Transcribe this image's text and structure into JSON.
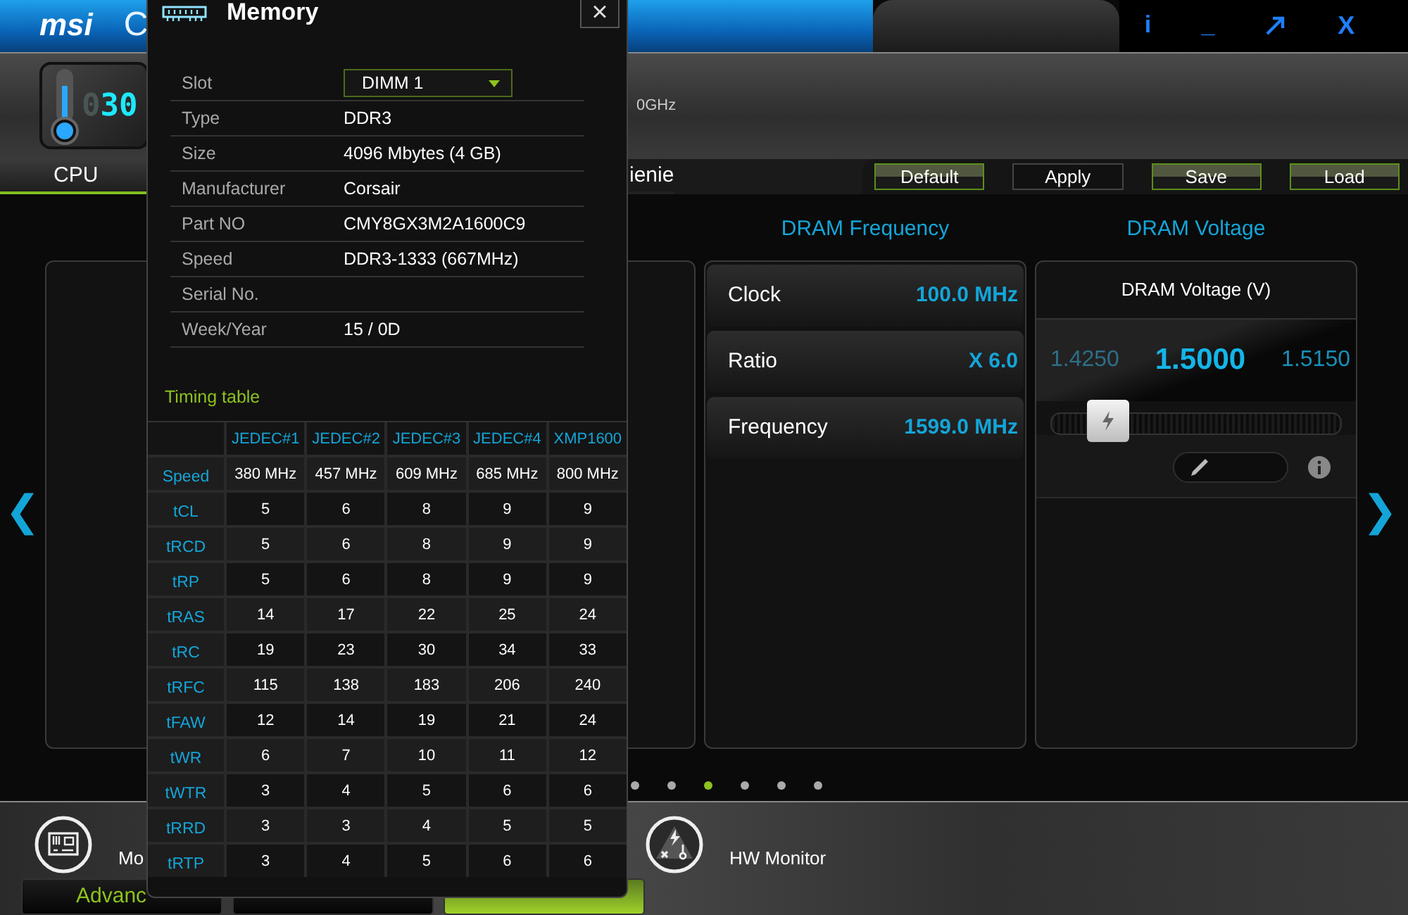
{
  "app": {
    "logo": "msi",
    "title": "C",
    "info": "i",
    "minimize": "_",
    "close": "X"
  },
  "temperature": {
    "dim_digit": "0",
    "digits": "30"
  },
  "cpu_info": "0GHz",
  "tabs": [
    {
      "label": "CPU",
      "selected": true
    },
    {
      "label": "ienie",
      "selected": false
    }
  ],
  "actions": [
    {
      "label": "Default",
      "kind": "green"
    },
    {
      "label": "Apply",
      "kind": "dark"
    },
    {
      "label": "Save",
      "kind": "green"
    },
    {
      "label": "Load",
      "kind": "green"
    }
  ],
  "headings": [
    "DRAM Frequency",
    "DRAM Voltage"
  ],
  "frequency": [
    {
      "label": "Clock",
      "value": "100.0 MHz"
    },
    {
      "label": "Ratio",
      "value": "X 6.0"
    },
    {
      "label": "Frequency",
      "value": "1599.0 MHz"
    }
  ],
  "voltage": {
    "title": "DRAM Voltage (V)",
    "previous": "1.4250",
    "current": "1.5000",
    "next": "1.5150",
    "level": 0.2
  },
  "nav": {
    "prev": "❮",
    "next": "❯"
  },
  "pager": [
    {
      "selected": false
    },
    {
      "selected": false
    },
    {
      "selected": true
    },
    {
      "selected": false
    },
    {
      "selected": false
    },
    {
      "selected": false
    }
  ],
  "bottom": {
    "items": [
      {
        "label": "Mo",
        "kind": "board"
      },
      {
        "label": "HW Monitor",
        "kind": "monitor"
      }
    ],
    "tabs": [
      {
        "label": "Advanc",
        "selected": false
      },
      {
        "selected": false
      },
      {
        "selected": true
      }
    ]
  },
  "dialog": {
    "title": "Memory",
    "close": "×",
    "slot": {
      "label": "Slot",
      "value": "DIMM 1"
    },
    "rows": [
      {
        "label": "Type",
        "value": "DDR3"
      },
      {
        "label": "Size",
        "value": "4096 Mbytes (4 GB)"
      },
      {
        "label": "Manufacturer",
        "value": "Corsair"
      },
      {
        "label": "Part NO",
        "value": "CMY8GX3M2A1600C9"
      },
      {
        "label": "Speed",
        "value": "DDR3-1333 (667MHz)"
      },
      {
        "label": "Serial No."
      },
      {
        "label": "Week/Year",
        "value": "15 / 0D"
      }
    ],
    "timing_title": "Timing table",
    "timing": {
      "columns": [
        "JEDEC#1",
        "JEDEC#2",
        "JEDEC#3",
        "JEDEC#4",
        "XMP1600"
      ],
      "rows": [
        {
          "label": "Speed",
          "values": [
            "380 MHz",
            "457 MHz",
            "609 MHz",
            "685 MHz",
            "800 MHz"
          ]
        },
        {
          "label": "tCL",
          "values": [
            "5",
            "6",
            "8",
            "9",
            "9"
          ]
        },
        {
          "label": "tRCD",
          "values": [
            "5",
            "6",
            "8",
            "9",
            "9"
          ]
        },
        {
          "label": "tRP",
          "values": [
            "5",
            "6",
            "8",
            "9",
            "9"
          ]
        },
        {
          "label": "tRAS",
          "values": [
            "14",
            "17",
            "22",
            "25",
            "24"
          ]
        },
        {
          "label": "tRC",
          "values": [
            "19",
            "23",
            "30",
            "34",
            "33"
          ]
        },
        {
          "label": "tRFC",
          "values": [
            "115",
            "138",
            "183",
            "206",
            "240"
          ]
        },
        {
          "label": "tFAW",
          "values": [
            "12",
            "14",
            "19",
            "21",
            "24"
          ]
        },
        {
          "label": "tWR",
          "values": [
            "6",
            "7",
            "10",
            "11",
            "12"
          ]
        },
        {
          "label": "tWTR",
          "values": [
            "3",
            "4",
            "5",
            "6",
            "6"
          ]
        },
        {
          "label": "tRRD",
          "values": [
            "3",
            "3",
            "4",
            "5",
            "5"
          ]
        },
        {
          "label": "tRTP",
          "values": [
            "3",
            "4",
            "5",
            "6",
            "6"
          ]
        }
      ]
    }
  }
}
